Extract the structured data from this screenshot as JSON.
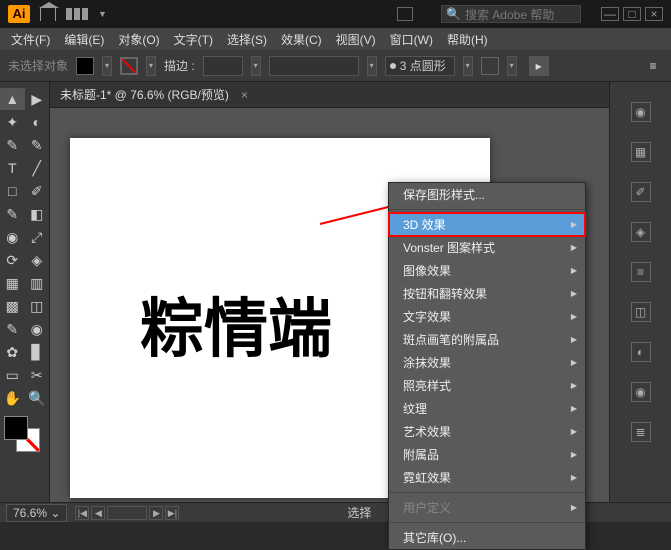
{
  "titlebar": {
    "search_placeholder": "搜索 Adobe 帮助"
  },
  "menu": {
    "file": "文件(F)",
    "edit": "编辑(E)",
    "object": "对象(O)",
    "type": "文字(T)",
    "select": "选择(S)",
    "effect": "效果(C)",
    "view": "视图(V)",
    "window": "窗口(W)",
    "help": "帮助(H)"
  },
  "options": {
    "no_selection": "未选择对象",
    "stroke_label": "描边 :",
    "stroke_style": "3 点圆形"
  },
  "doc": {
    "tab": "未标题-1* @ 76.6% (RGB/预览)",
    "artwork_text": "粽情端"
  },
  "dropdown": {
    "save_style": "保存图形样式...",
    "three_d": "3D 效果",
    "vonster": "Vonster 图案样式",
    "image_fx": "图像效果",
    "button_fx": "按钮和翻转效果",
    "text_fx": "文字效果",
    "scribble": "斑点画笔的附属品",
    "smudge": "涂抹效果",
    "glow": "照亮样式",
    "texture": "纹理",
    "artistic": "艺术效果",
    "additions": "附属品",
    "neon": "霓虹效果",
    "user_defined": "用户定义",
    "other_lib": "其它库(O)..."
  },
  "status": {
    "zoom": "76.6%",
    "select": "选择"
  }
}
